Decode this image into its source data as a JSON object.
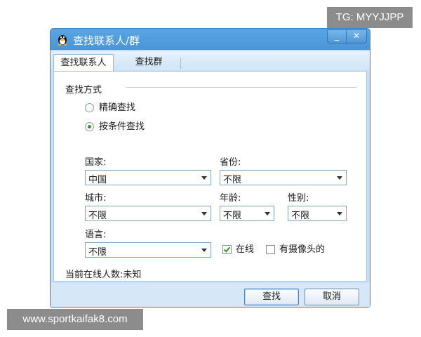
{
  "watermarks": {
    "top": "TG: MYYJJPP",
    "bottom": "www.sportkaifak8.com"
  },
  "window": {
    "title": "查找联系人/群",
    "min_label": "_",
    "close_label": "✕",
    "app_icon": "qq-penguin-icon"
  },
  "tabs": [
    {
      "label": "查找联系人",
      "active": true
    },
    {
      "label": "查找群",
      "active": false
    }
  ],
  "search_mode": {
    "label": "查找方式",
    "options": [
      {
        "label": "精确查找",
        "selected": false
      },
      {
        "label": "按条件查找",
        "selected": true
      }
    ]
  },
  "fields": {
    "country": {
      "label": "国家:",
      "value": "中国"
    },
    "province": {
      "label": "省份:",
      "value": "不限"
    },
    "city": {
      "label": "城市:",
      "value": "不限"
    },
    "age": {
      "label": "年龄:",
      "value": "不限"
    },
    "gender": {
      "label": "性别:",
      "value": "不限"
    },
    "language": {
      "label": "语言:",
      "value": "不限"
    }
  },
  "checkboxes": {
    "online": {
      "label": "在线",
      "checked": true
    },
    "webcam": {
      "label": "有摄像头的",
      "checked": false
    }
  },
  "status": "当前在线人数:未知",
  "buttons": {
    "find": "查找",
    "cancel": "取消"
  },
  "colors": {
    "title_bar": "#4a94d6",
    "check_mark": "#2f9a2f",
    "accent_border": "#3d83c8"
  }
}
